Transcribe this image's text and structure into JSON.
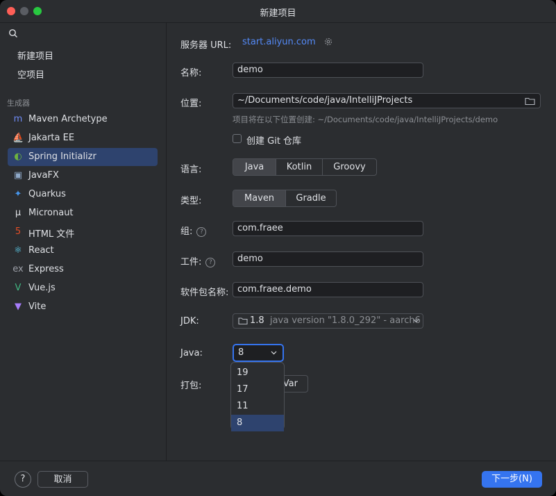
{
  "window": {
    "title": "新建项目"
  },
  "sidebar": {
    "top_items": [
      "新建项目",
      "空项目"
    ],
    "group_label": "生成器",
    "generators": [
      {
        "label": "Maven Archetype",
        "icon": "maven-icon",
        "glyph": "m",
        "color": "#6f8bf5"
      },
      {
        "label": "Jakarta EE",
        "icon": "jakarta-icon",
        "glyph": "⛵",
        "color": "#f0a930"
      },
      {
        "label": "Spring Initializr",
        "icon": "spring-icon",
        "glyph": "◐",
        "color": "#6db33f"
      },
      {
        "label": "JavaFX",
        "icon": "javafx-icon",
        "glyph": "▣",
        "color": "#8fa9c9"
      },
      {
        "label": "Quarkus",
        "icon": "quarkus-icon",
        "glyph": "✦",
        "color": "#4695eb"
      },
      {
        "label": "Micronaut",
        "icon": "micronaut-icon",
        "glyph": "μ",
        "color": "#dfe1e5"
      },
      {
        "label": "HTML 文件",
        "icon": "html5-icon",
        "glyph": "5",
        "color": "#e44d26"
      },
      {
        "label": "React",
        "icon": "react-icon",
        "glyph": "⚛",
        "color": "#61dafb"
      },
      {
        "label": "Express",
        "icon": "express-icon",
        "glyph": "ex",
        "color": "#9da0a8"
      },
      {
        "label": "Vue.js",
        "icon": "vue-icon",
        "glyph": "V",
        "color": "#41b883"
      },
      {
        "label": "Vite",
        "icon": "vite-icon",
        "glyph": "▼",
        "color": "#a67cfa"
      }
    ],
    "selected_index": 2
  },
  "form": {
    "server_label": "服务器 URL:",
    "server_url": "start.aliyun.com",
    "name_label": "名称:",
    "name_value": "demo",
    "location_label": "位置:",
    "location_value": "~/Documents/code/java/IntelliJProjects",
    "location_hint": "项目将在以下位置创建: ~/Documents/code/java/IntelliJProjects/demo",
    "git_label": "创建 Git 仓库",
    "language_label": "语言:",
    "languages": [
      "Java",
      "Kotlin",
      "Groovy"
    ],
    "type_label": "类型:",
    "types": [
      "Maven",
      "Gradle"
    ],
    "group_label": "组:",
    "group_value": "com.fraee",
    "artifact_label": "工件:",
    "artifact_value": "demo",
    "package_label": "软件包名称:",
    "package_value": "com.fraee.demo",
    "jdk_label": "JDK:",
    "jdk_version": "1.8",
    "jdk_detail": "java version \"1.8.0_292\" - aarch6",
    "java_label": "Java:",
    "java_value": "8",
    "java_options": [
      "19",
      "17",
      "11",
      "8"
    ],
    "packaging_label": "打包:",
    "packaging_visible": "Var"
  },
  "footer": {
    "help": "?",
    "cancel": "取消",
    "next": "下一步(N)"
  },
  "colors": {
    "accent": "#3574f0",
    "selection": "#2e436e",
    "link": "#548af7"
  }
}
